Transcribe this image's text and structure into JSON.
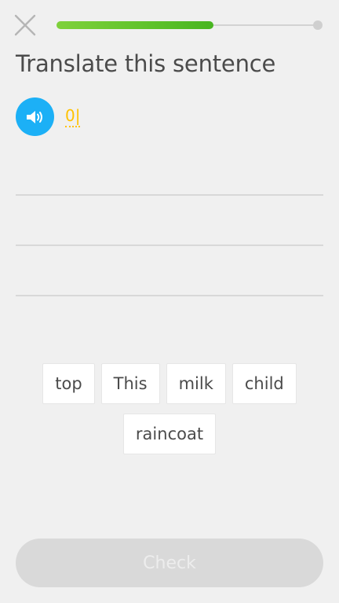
{
  "header": {
    "close_icon": "close-icon",
    "progress": {
      "value": 0.6
    }
  },
  "exercise": {
    "title": "Translate this sentence",
    "speaker_icon": "speaker-icon",
    "prompt_text": "0|"
  },
  "word_bank": {
    "row1": [
      "top",
      "This",
      "milk",
      "child"
    ],
    "row2": [
      "raincoat"
    ]
  },
  "footer": {
    "check_label": "Check"
  },
  "colors": {
    "accent_blue": "#1cb0f6",
    "progress_green": "#58c22a",
    "prompt_yellow": "#ffc200",
    "disabled_gray": "#d9d9d9"
  }
}
